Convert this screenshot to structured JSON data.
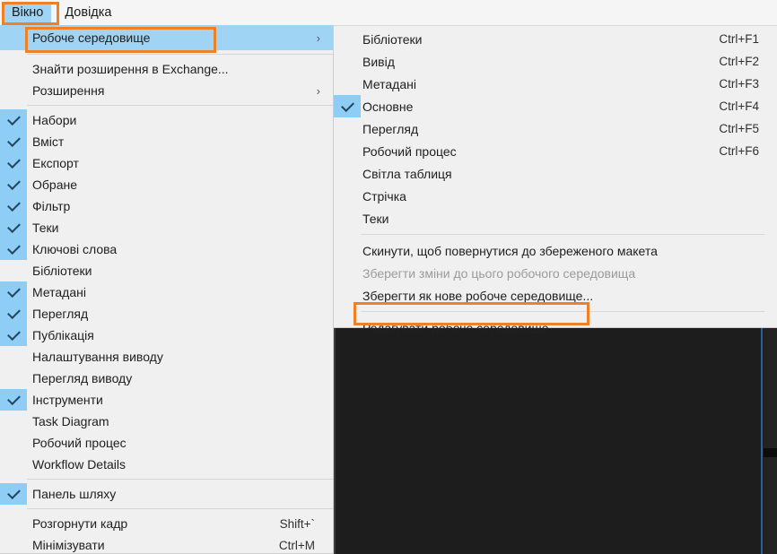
{
  "app": {
    "menubar": {
      "items": [
        {
          "label": "Вікно",
          "state": "active"
        },
        {
          "label": "Довідка",
          "state": "normal"
        }
      ]
    }
  },
  "main_menu": {
    "items": [
      {
        "label": "Робоче середовище",
        "checked": false,
        "highlight": true,
        "submenu": true,
        "arrow": "›"
      },
      {
        "sep": true
      },
      {
        "label": "Знайти розширення в Exchange...",
        "checked": false
      },
      {
        "label": "Розширення",
        "checked": false,
        "submenu": true,
        "arrow": "›"
      },
      {
        "sep": true
      },
      {
        "label": "Набори",
        "checked": true
      },
      {
        "label": "Вміст",
        "checked": true
      },
      {
        "label": "Експорт",
        "checked": true
      },
      {
        "label": "Обране",
        "checked": true
      },
      {
        "label": "Фільтр",
        "checked": true
      },
      {
        "label": "Теки",
        "checked": true
      },
      {
        "label": "Ключові слова",
        "checked": true
      },
      {
        "label": "Бібліотеки",
        "checked": false
      },
      {
        "label": "Метадані",
        "checked": true
      },
      {
        "label": "Перегляд",
        "checked": true
      },
      {
        "label": "Публікація",
        "checked": true
      },
      {
        "label": "Налаштування виводу",
        "checked": false
      },
      {
        "label": "Перегляд виводу",
        "checked": false
      },
      {
        "label": "Інструменти",
        "checked": true
      },
      {
        "label": "Task Diagram",
        "checked": false
      },
      {
        "label": "Робочий процес",
        "checked": false
      },
      {
        "label": "Workflow Details",
        "checked": false
      },
      {
        "sep": true
      },
      {
        "label": "Панель шляху",
        "checked": true
      },
      {
        "sep": true
      },
      {
        "label": "Розгорнути кадр",
        "checked": false,
        "shortcut": "Shift+`"
      },
      {
        "label": "Мінімізувати",
        "checked": false,
        "shortcut": "Ctrl+M"
      }
    ]
  },
  "submenu": {
    "items": [
      {
        "label": "Бібліотеки",
        "checked": false,
        "shortcut": "Ctrl+F1"
      },
      {
        "label": "Вивід",
        "checked": false,
        "shortcut": "Ctrl+F2"
      },
      {
        "label": "Метадані",
        "checked": false,
        "shortcut": "Ctrl+F3"
      },
      {
        "label": "Основне",
        "checked": true,
        "shortcut": "Ctrl+F4"
      },
      {
        "label": "Перегляд",
        "checked": false,
        "shortcut": "Ctrl+F5"
      },
      {
        "label": "Робочий процес",
        "checked": false,
        "shortcut": "Ctrl+F6"
      },
      {
        "label": "Світла таблиця",
        "checked": false,
        "shortcut": ""
      },
      {
        "label": "Стрічка",
        "checked": false,
        "shortcut": ""
      },
      {
        "label": "Теки",
        "checked": false,
        "shortcut": ""
      },
      {
        "sep": true
      },
      {
        "label": "Скинути, щоб повернутися до збереженого макета",
        "checked": false,
        "shortcut": ""
      },
      {
        "label": "Зберегти зміни до цього робочого середовища",
        "checked": false,
        "shortcut": "",
        "disabled": true
      },
      {
        "label": "Зберегти як нове робоче середовище...",
        "checked": false,
        "shortcut": ""
      },
      {
        "sep": true
      },
      {
        "label": "Редагувати робоче середовище...",
        "checked": false,
        "shortcut": ""
      }
    ]
  },
  "annotations": {
    "color": "#ef8026",
    "boxes": [
      {
        "name": "menubar-window",
        "target": "Вікно"
      },
      {
        "name": "workspace-item",
        "target": "Робоче середовище"
      },
      {
        "name": "edit-workspace-item",
        "target": "Редагувати робоче середовище..."
      }
    ]
  },
  "canvas": {
    "background_color": "#1d1d1d",
    "accent_line_color": "#2c5f9e"
  }
}
